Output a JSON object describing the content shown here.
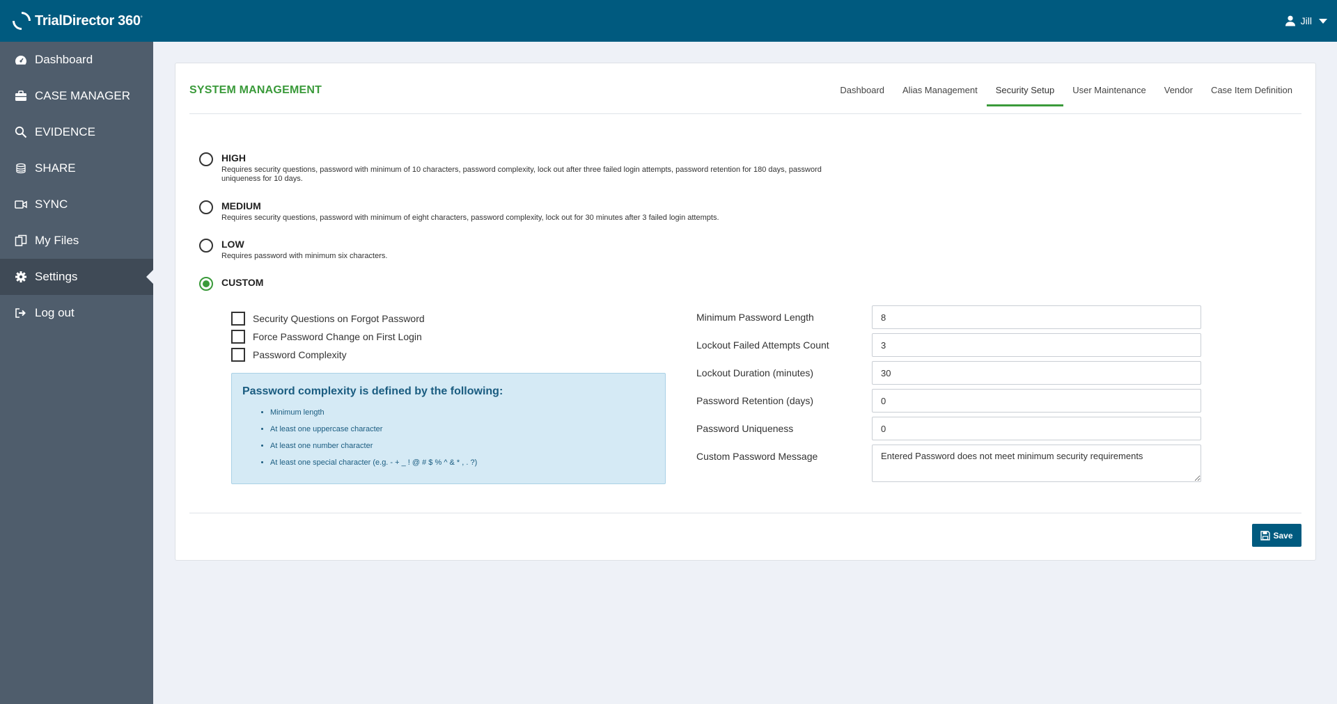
{
  "app": {
    "name": "TrialDirector 360",
    "trademark": "°"
  },
  "sidebar": {
    "items": [
      {
        "label": "Dashboard",
        "icon": "dashboard-gauge-icon"
      },
      {
        "label": "CASE MANAGER",
        "icon": "briefcase-icon"
      },
      {
        "label": "EVIDENCE",
        "icon": "magnifier-icon"
      },
      {
        "label": "SHARE",
        "icon": "stack-icon"
      },
      {
        "label": "SYNC",
        "icon": "video-camera-icon"
      },
      {
        "label": "My Files",
        "icon": "files-icon"
      },
      {
        "label": "Settings",
        "icon": "gear-icon",
        "active": true
      },
      {
        "label": "Log out",
        "icon": "sign-out-icon"
      }
    ]
  },
  "header": {
    "user_name": "Jill"
  },
  "page": {
    "title": "SYSTEM MANAGEMENT",
    "tabs": [
      {
        "label": "Dashboard"
      },
      {
        "label": "Alias Management"
      },
      {
        "label": "Security Setup",
        "active": true
      },
      {
        "label": "User Maintenance"
      },
      {
        "label": "Vendor"
      },
      {
        "label": "Case Item Definition"
      }
    ]
  },
  "security_levels": [
    {
      "label": "HIGH",
      "description": "Requires security questions, password with minimum of 10 characters, password complexity, lock out after three failed login attempts, password retention for 180 days, password uniqueness for 10 days.",
      "checked": false
    },
    {
      "label": "MEDIUM",
      "description": "Requires security questions, password with minimum of eight characters, password complexity, lock out for 30 minutes after 3 failed login attempts.",
      "checked": false
    },
    {
      "label": "LOW",
      "description": "Requires password with minimum six characters.",
      "checked": false
    },
    {
      "label": "CUSTOM",
      "description": "",
      "checked": true
    }
  ],
  "custom_options": [
    {
      "label": "Security Questions on Forgot Password",
      "checked": false
    },
    {
      "label": "Force Password Change on First Login",
      "checked": false
    },
    {
      "label": "Password Complexity",
      "checked": false
    }
  ],
  "complexity_info": {
    "title": "Password complexity is defined by the following:",
    "items": [
      "Minimum length",
      "At least one uppercase character",
      "At least one number character",
      "At least one special character (e.g. - + _ ! @ # $ % ^ & * , . ?)"
    ]
  },
  "fields": {
    "min_length": {
      "label": "Minimum Password Length",
      "value": "8"
    },
    "lockout_count": {
      "label": "Lockout Failed Attempts Count",
      "value": "3"
    },
    "lockout_duration": {
      "label": "Lockout Duration (minutes)",
      "value": "30"
    },
    "retention": {
      "label": "Password Retention (days)",
      "value": "0"
    },
    "uniqueness": {
      "label": "Password Uniqueness",
      "value": "0"
    },
    "custom_message": {
      "label": "Custom Password Message",
      "value": "Entered Password does not meet minimum security requirements"
    }
  },
  "actions": {
    "save_label": "Save"
  },
  "colors": {
    "header": "#005a7f",
    "sidebar": "#4f5d6c",
    "accent_green": "#3a9a3a",
    "info_bg": "#d5eaf5"
  }
}
